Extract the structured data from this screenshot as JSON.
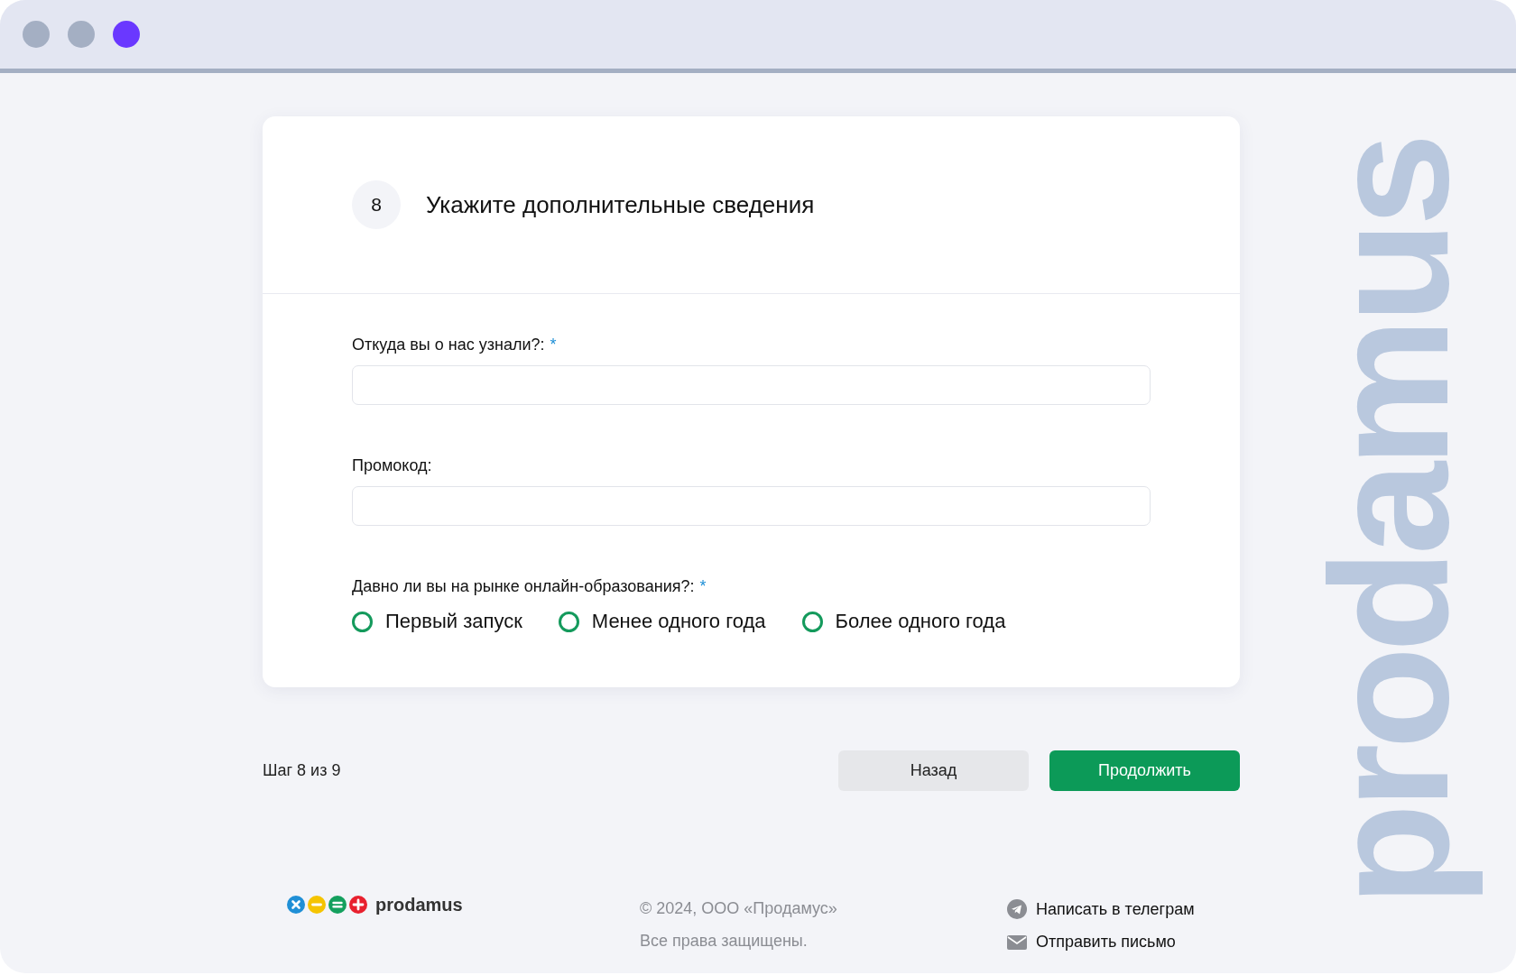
{
  "window": {
    "dots": [
      {
        "color": "#a4afc3"
      },
      {
        "color": "#a4afc3"
      },
      {
        "color": "#6a38ff"
      }
    ]
  },
  "backdrop": {
    "word": "prodamus"
  },
  "card": {
    "step_number": "8",
    "title": "Укажите дополнительные сведения",
    "fields": [
      {
        "kind": "text",
        "label": "Откуда вы о нас узнали?:",
        "required_mark": "*"
      },
      {
        "kind": "text",
        "label": "Промокод:"
      },
      {
        "kind": "radio",
        "label": "Давно ли вы на рынке онлайн-образования?:",
        "required_mark": "*",
        "options": [
          {
            "label": "Первый запуск",
            "selected": false
          },
          {
            "label": "Менее одного года",
            "selected": false
          },
          {
            "label": "Более одного года",
            "selected": false
          }
        ]
      }
    ]
  },
  "progress": {
    "text": "Шаг 8 из 9"
  },
  "buttons": [
    {
      "kind": "secondary",
      "label": "Назад"
    },
    {
      "kind": "primary",
      "label": "Продолжить"
    }
  ],
  "footer": {
    "logo_text": "prodamus",
    "copyright": "© 2024, ООО «Продамус»",
    "rights": "Все права защищены.",
    "links": [
      {
        "kind": "telegram",
        "label": "Написать в телеграм"
      },
      {
        "kind": "mail",
        "label": "Отправить письмо"
      }
    ]
  }
}
